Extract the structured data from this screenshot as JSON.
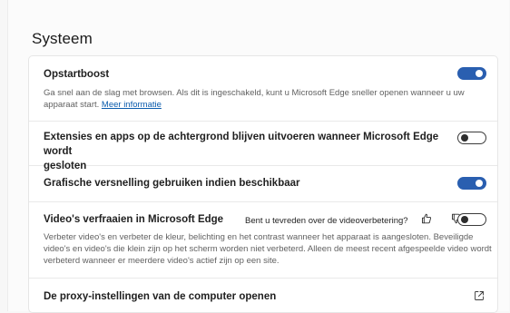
{
  "section": {
    "title": "Systeem"
  },
  "settings": [
    {
      "title": "Opstartboost",
      "description": "Ga snel aan de slag met browsen. Als dit is ingeschakeld, kunt u Microsoft Edge sneller openen wanneer u uw apparaat start.",
      "link_text": "Meer informatie",
      "toggle": "on"
    },
    {
      "title_line1": "Extensies en apps op de achtergrond blijven uitvoeren wanneer Microsoft Edge wordt",
      "title_line2": "gesloten",
      "toggle": "off"
    },
    {
      "title": "Grafische versnelling gebruiken indien beschikbaar",
      "toggle": "on"
    },
    {
      "title": "Video's verfraaien in Microsoft Edge",
      "feedback_question": "Bent u tevreden over de videoverbetering?",
      "description_line1": "Verbeter video's en verbeter de kleur, belichting en het contrast wanneer het apparaat is aangesloten. Beveiligde",
      "description_line2": "video's en video's die klein zijn op het scherm worden niet verbeterd. Alleen de meest recent afgespeelde video wordt",
      "description_line3": "verbeterd wanneer er meerdere video's actief zijn op een site.",
      "toggle": "off"
    },
    {
      "title": "De proxy-instellingen van de computer openen",
      "icon": "external-link-icon"
    }
  ],
  "colors": {
    "accent": "#2a5fb0",
    "link": "#0b5cad"
  }
}
